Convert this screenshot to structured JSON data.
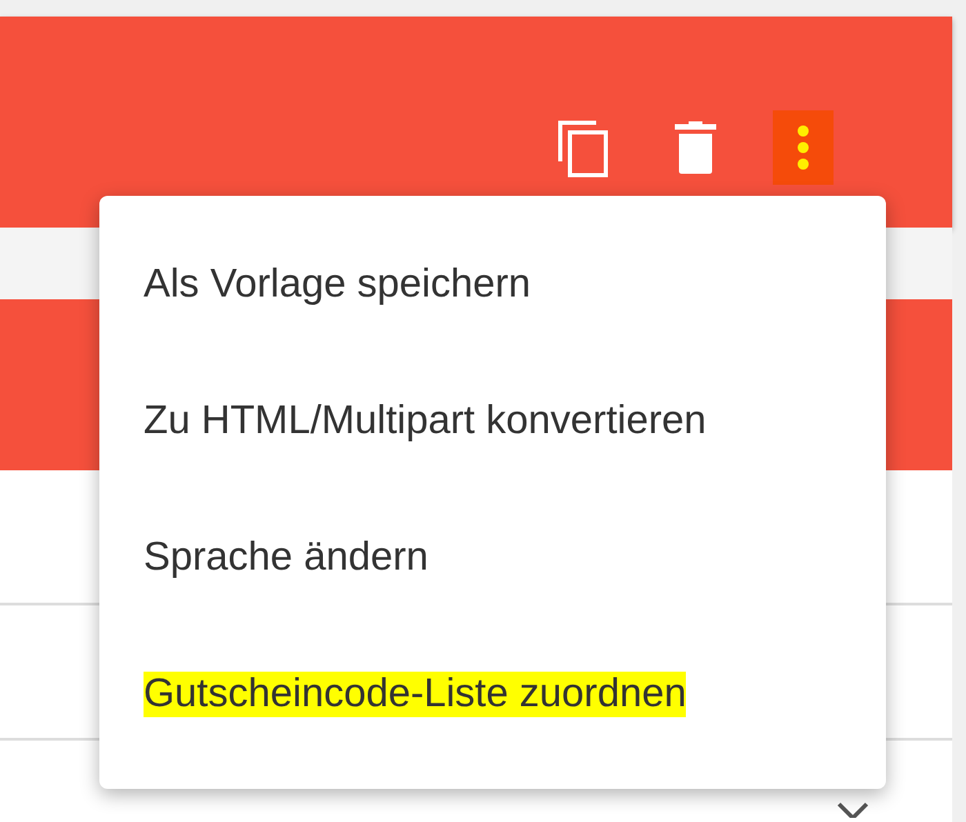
{
  "toolbar": {
    "actions": [
      {
        "kind": "copy",
        "highlighted": false
      },
      {
        "kind": "delete",
        "highlighted": false
      },
      {
        "kind": "more",
        "highlighted": true
      }
    ]
  },
  "menu": {
    "items": [
      {
        "label": "Als Vorlage speichern",
        "highlighted": false
      },
      {
        "label": "Zu HTML/Multipart konvertieren",
        "highlighted": false
      },
      {
        "label": "Sprache ändern",
        "highlighted": false
      },
      {
        "label": "Gutscheincode-Liste zuordnen",
        "highlighted": true
      }
    ]
  }
}
